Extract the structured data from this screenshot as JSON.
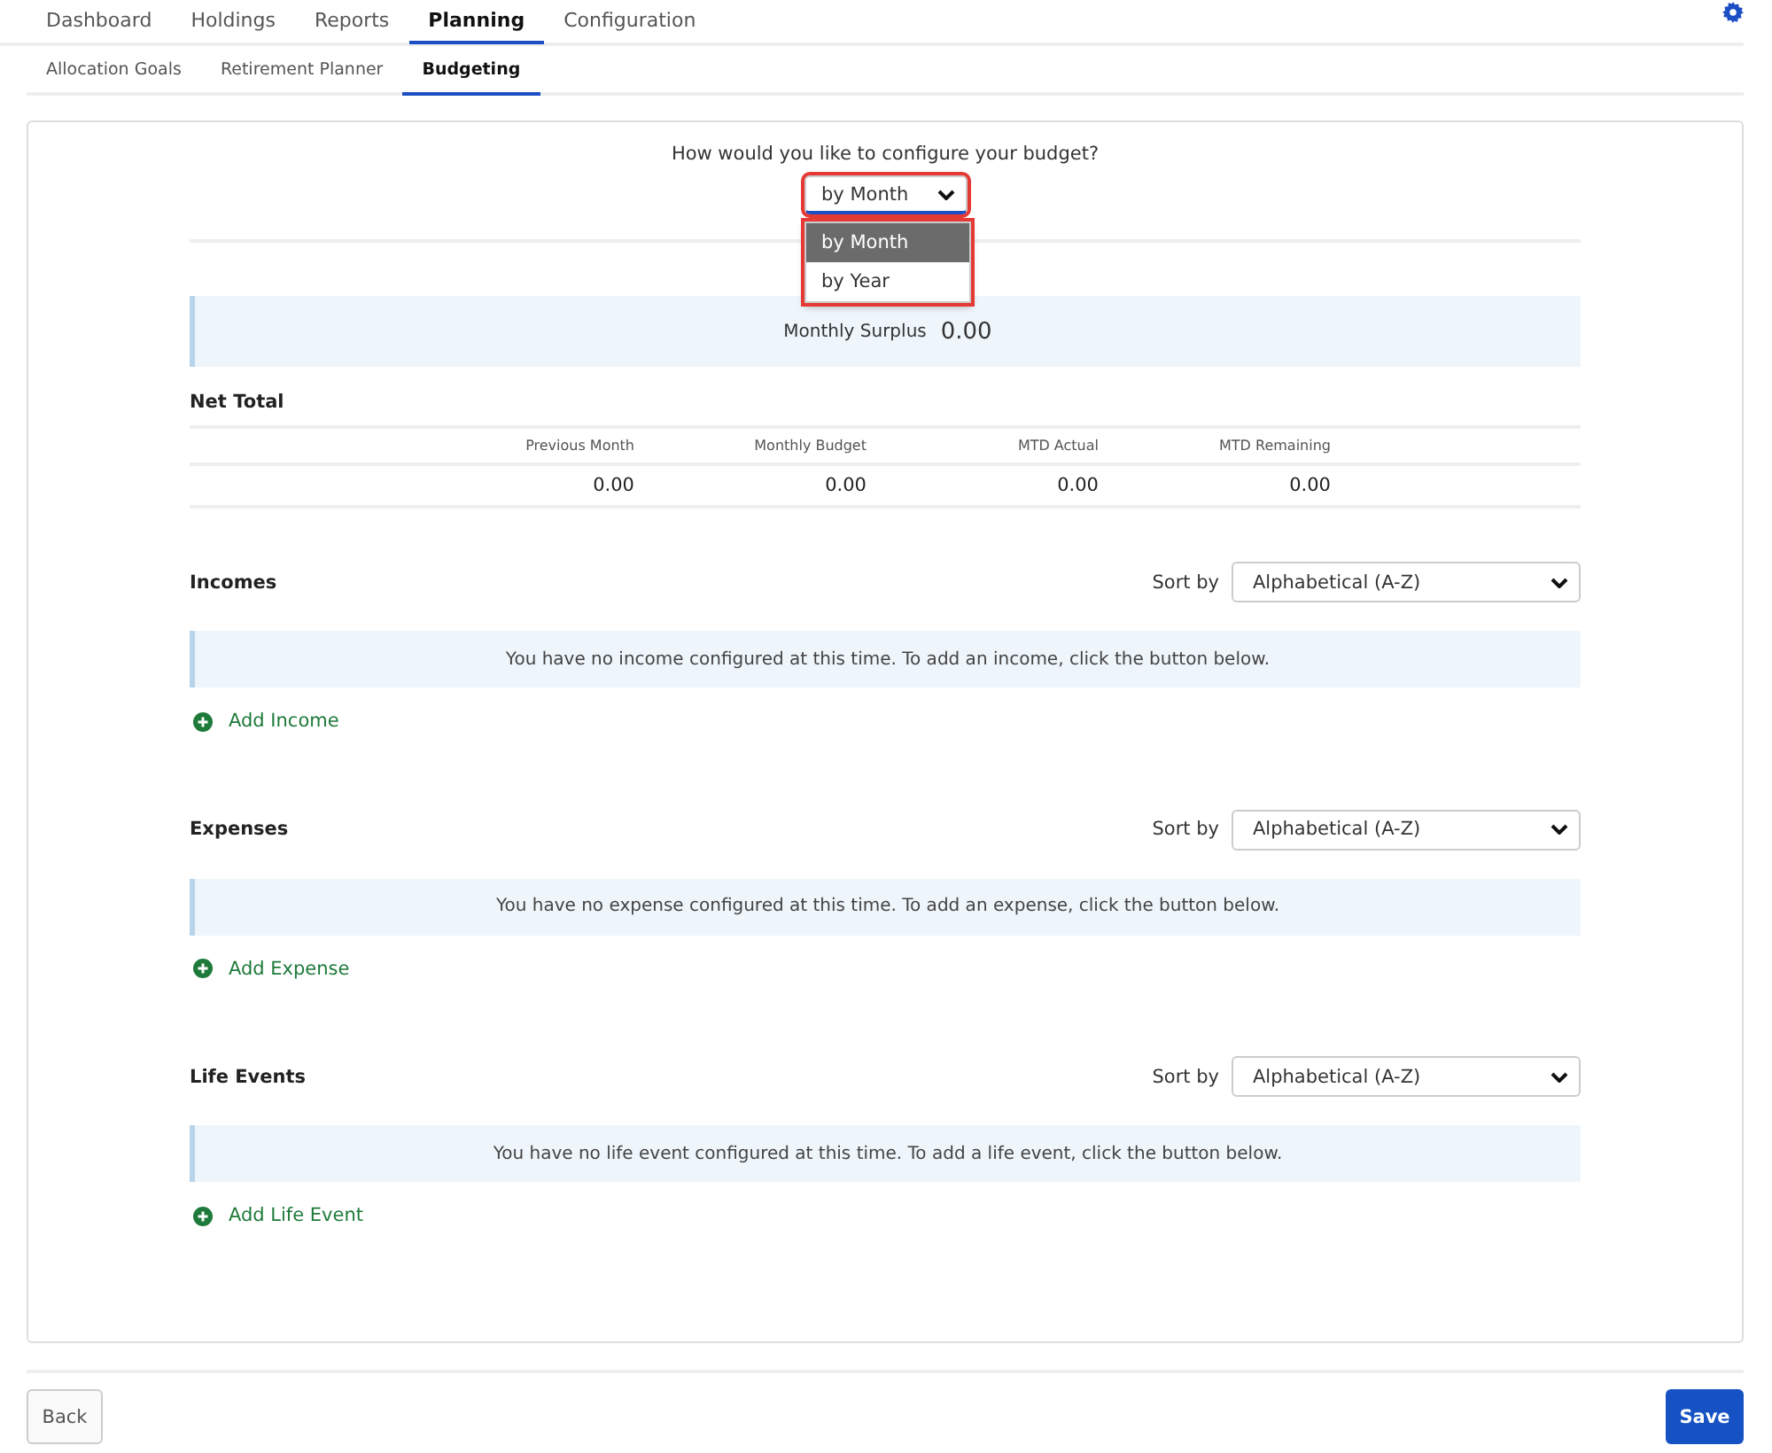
{
  "main_tabs": [
    {
      "label": "Dashboard",
      "selected": false
    },
    {
      "label": "Holdings",
      "selected": false
    },
    {
      "label": "Reports",
      "selected": false
    },
    {
      "label": "Planning",
      "selected": true
    },
    {
      "label": "Configuration",
      "selected": false
    }
  ],
  "sub_tabs": [
    {
      "label": "Allocation Goals",
      "selected": false
    },
    {
      "label": "Retirement Planner",
      "selected": false
    },
    {
      "label": "Budgeting",
      "selected": true
    }
  ],
  "budget_config": {
    "question": "How would you like to configure your budget?",
    "value": "by Month",
    "expanded": true,
    "options": [
      {
        "label": "by Month",
        "selected": true
      },
      {
        "label": "by Year",
        "selected": false
      }
    ]
  },
  "surplus": {
    "label": "Monthly Surplus",
    "value": "0.00"
  },
  "net_total": {
    "title": "Net Total",
    "columns": [
      "Previous Month",
      "Monthly Budget",
      "MTD Actual",
      "MTD Remaining"
    ],
    "values": [
      "0.00",
      "0.00",
      "0.00",
      "0.00"
    ]
  },
  "sections": [
    {
      "title": "Incomes",
      "sort_label": "Sort by",
      "sort_value": "Alphabetical (A-Z)",
      "message": "You have no income configured at this time. To add an income, click the button below.",
      "add_label": "Add Income"
    },
    {
      "title": "Expenses",
      "sort_label": "Sort by",
      "sort_value": "Alphabetical (A-Z)",
      "message": "You have no expense configured at this time. To add an expense, click the button below.",
      "add_label": "Add Expense"
    },
    {
      "title": "Life Events",
      "sort_label": "Sort by",
      "sort_value": "Alphabetical (A-Z)",
      "message": "You have no life event configured at this time. To add a life event, click the button below.",
      "add_label": "Add Life Event"
    }
  ],
  "buttons": {
    "back": "Back",
    "save": "Save"
  }
}
